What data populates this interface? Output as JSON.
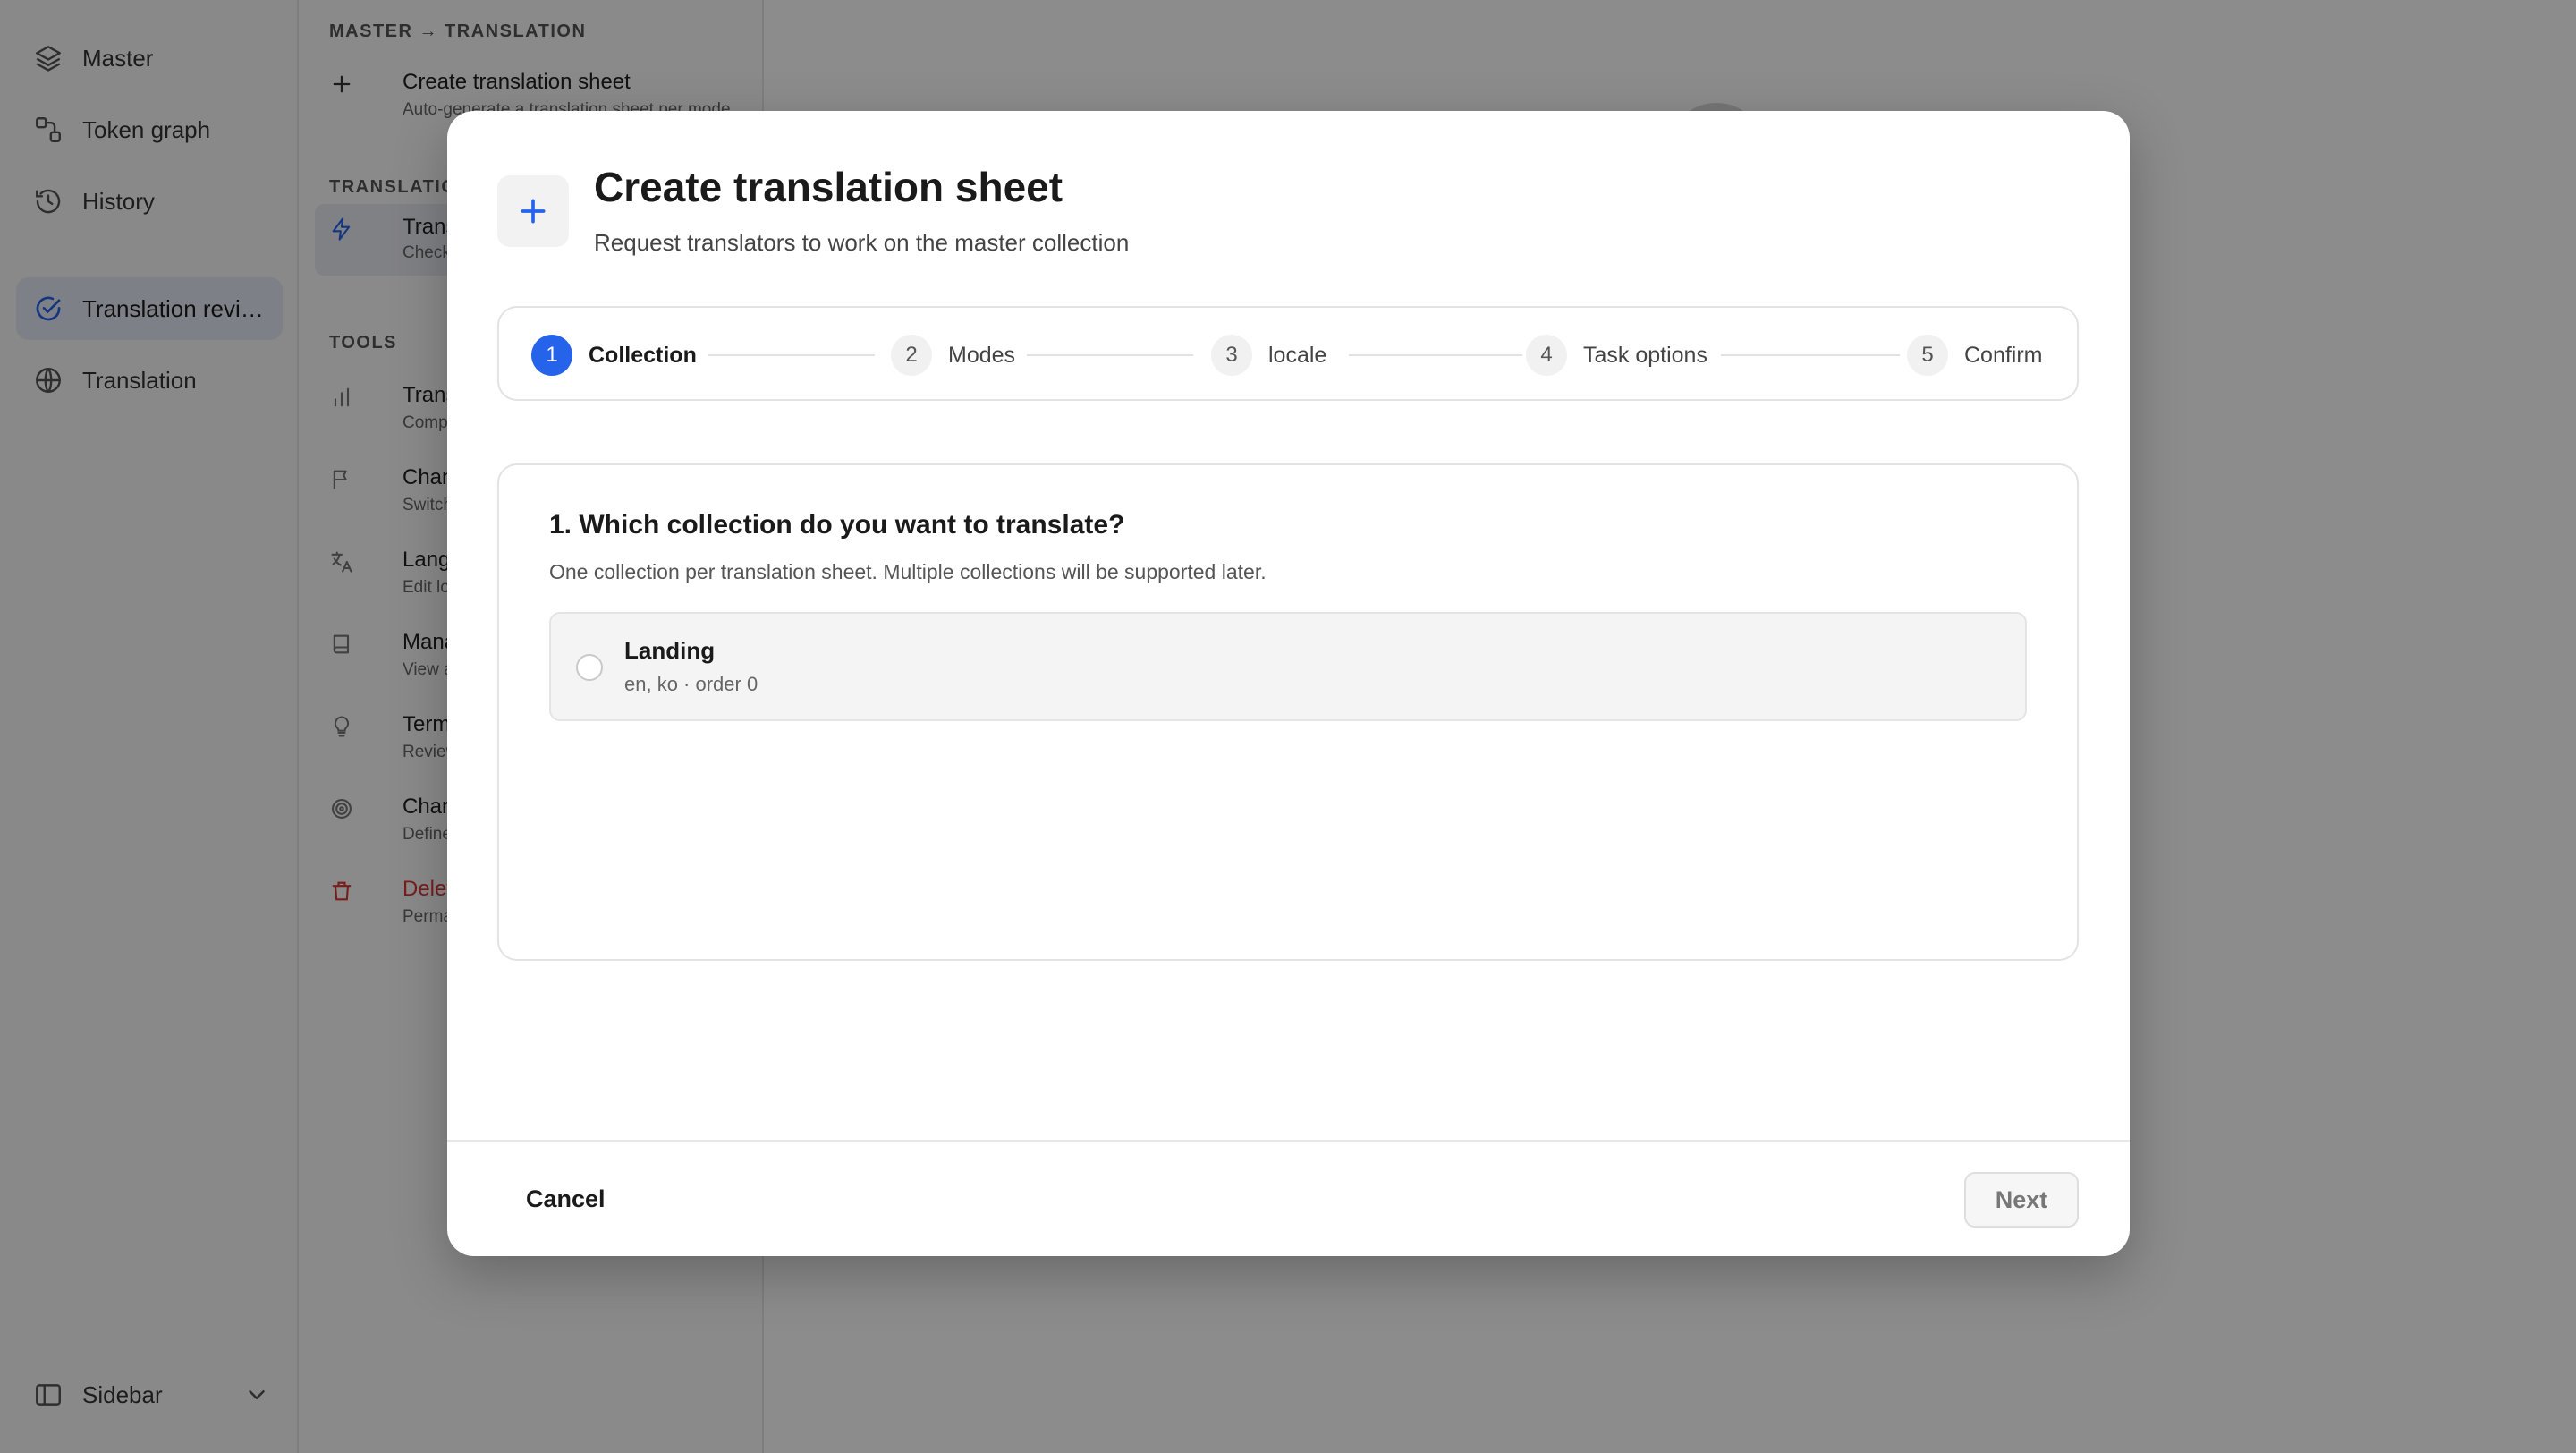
{
  "sidebar": {
    "items": [
      {
        "label": "Master",
        "icon": "layers-icon"
      },
      {
        "label": "Token graph",
        "icon": "graph-icon"
      },
      {
        "label": "History",
        "icon": "history-icon"
      },
      {
        "label": "Translation revi…",
        "icon": "check-circle-icon",
        "active": true
      },
      {
        "label": "Translation",
        "icon": "globe-icon"
      }
    ],
    "footer_label": "Sidebar"
  },
  "panel": {
    "section1": "MASTER → TRANSLATION",
    "create": {
      "title": "Create translation sheet",
      "subtitle": "Auto-generate a translation sheet per mode"
    },
    "section2": "TRANSLATIO",
    "review": {
      "title": "Transla",
      "subtitle": "Check ch"
    },
    "section3": "TOOLS",
    "tools": [
      {
        "title": "Transla",
        "subtitle": "Complet",
        "icon": "bar-chart-icon"
      },
      {
        "title": "Change",
        "subtitle": "Switch th",
        "icon": "flag-icon"
      },
      {
        "title": "Langua",
        "subtitle": "Edit local",
        "icon": "language-icon"
      },
      {
        "title": "Manage",
        "subtitle": "View and",
        "icon": "book-icon"
      },
      {
        "title": "Term su",
        "subtitle": "Review th",
        "icon": "lightbulb-icon"
      },
      {
        "title": "Charact",
        "subtitle": "Define m",
        "icon": "target-icon"
      },
      {
        "title": "Delete t",
        "subtitle": "Permane",
        "icon": "trash-icon",
        "danger": true
      }
    ]
  },
  "modal": {
    "title": "Create translation sheet",
    "subtitle": "Request translators to work on the master collection",
    "steps": [
      {
        "num": "1",
        "label": "Collection",
        "active": true
      },
      {
        "num": "2",
        "label": "Modes"
      },
      {
        "num": "3",
        "label": "locale"
      },
      {
        "num": "4",
        "label": "Task options"
      },
      {
        "num": "5",
        "label": "Confirm"
      }
    ],
    "question": "1. Which collection do you want to translate?",
    "question_sub": "One collection per translation sheet. Multiple collections will be supported later.",
    "option": {
      "name": "Landing",
      "meta": "en, ko · order 0"
    },
    "cancel_label": "Cancel",
    "next_label": "Next"
  },
  "colors": {
    "accent": "#2563eb",
    "danger": "#d33333"
  }
}
